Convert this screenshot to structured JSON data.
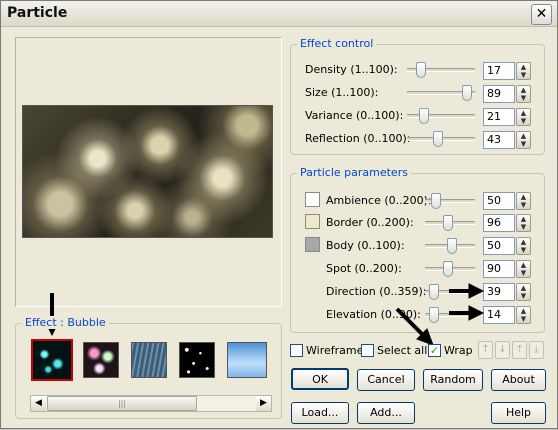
{
  "window": {
    "title": "Particle",
    "close_glyph": "✕"
  },
  "effect_control": {
    "title": "Effect control",
    "rows": [
      {
        "label": "Density (1..100):",
        "value": "17"
      },
      {
        "label": "Size (1..100):",
        "value": "89"
      },
      {
        "label": "Variance (0..100):",
        "value": "21"
      },
      {
        "label": "Reflection (0..100):",
        "value": "43"
      }
    ]
  },
  "particle_parameters": {
    "title": "Particle parameters",
    "rows": [
      {
        "label": "Ambience (0..200):",
        "value": "50",
        "swatch": "#ffffff"
      },
      {
        "label": "Border (0..200):",
        "value": "96",
        "swatch": "#eeeac8"
      },
      {
        "label": "Body (0..100):",
        "value": "50",
        "swatch": "#a8a8a8"
      },
      {
        "label": "Spot (0..200):",
        "value": "90"
      },
      {
        "label": "Direction (0..359):",
        "value": "39"
      },
      {
        "label": "Elevation (0..90):",
        "value": "14"
      }
    ]
  },
  "effect_group": {
    "title": "Effect : Bubble"
  },
  "options": {
    "wireframe": {
      "label": "Wireframe",
      "checked": false
    },
    "select_all": {
      "label": "Select all",
      "checked": false
    },
    "wrap": {
      "label": "Wrap",
      "checked": true,
      "mark": "✓"
    }
  },
  "buttons": {
    "ok": "OK",
    "cancel": "Cancel",
    "random": "Random",
    "about": "About",
    "load": "Load...",
    "add": "Add...",
    "help": "Help"
  },
  "arrows": {
    "up": "↑",
    "down": "↓",
    "top": "⤒",
    "bottom": "⤓"
  },
  "scroll": {
    "left": "◀",
    "right": "▶",
    "grip": "|||"
  },
  "colors": {
    "accent": "#0046d5",
    "selection": "#cc0000"
  }
}
